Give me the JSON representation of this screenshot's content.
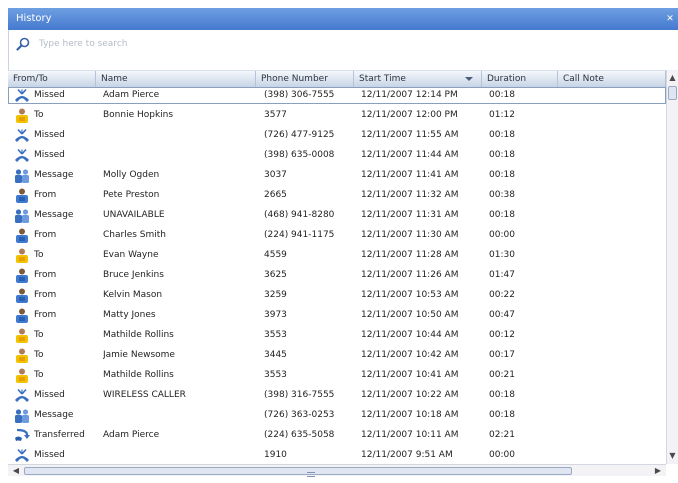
{
  "window": {
    "title": "History"
  },
  "search": {
    "placeholder": "Type here to search"
  },
  "columns": [
    {
      "key": "from_to",
      "label": "From/To"
    },
    {
      "key": "name",
      "label": "Name"
    },
    {
      "key": "phone",
      "label": "Phone Number"
    },
    {
      "key": "start_time",
      "label": "Start Time",
      "sorted": "descending"
    },
    {
      "key": "duration",
      "label": "Duration"
    },
    {
      "key": "call_note",
      "label": "Call Note"
    }
  ],
  "rows": [
    {
      "type": "Missed",
      "icon": "missed-call-icon",
      "name": "Adam Pierce",
      "phone": "(398) 306-7555",
      "start": "12/11/2007 12:14 PM",
      "duration": "00:18",
      "note": "",
      "selected": true
    },
    {
      "type": "To",
      "icon": "outgoing-call-icon",
      "name": "Bonnie Hopkins",
      "phone": "3577",
      "start": "12/11/2007 12:00 PM",
      "duration": "01:12",
      "note": ""
    },
    {
      "type": "Missed",
      "icon": "missed-call-icon",
      "name": "",
      "phone": "(726) 477-9125",
      "start": "12/11/2007 11:55 AM",
      "duration": "00:18",
      "note": ""
    },
    {
      "type": "Missed",
      "icon": "missed-call-icon",
      "name": "",
      "phone": "(398) 635-0008",
      "start": "12/11/2007 11:44 AM",
      "duration": "00:18",
      "note": ""
    },
    {
      "type": "Message",
      "icon": "voicemail-icon",
      "name": "Molly Ogden",
      "phone": "3037",
      "start": "12/11/2007 11:41 AM",
      "duration": "00:18",
      "note": ""
    },
    {
      "type": "From",
      "icon": "incoming-call-icon",
      "name": "Pete Preston",
      "phone": "2665",
      "start": "12/11/2007 11:32 AM",
      "duration": "00:38",
      "note": ""
    },
    {
      "type": "Message",
      "icon": "voicemail-icon",
      "name": "UNAVAILABLE",
      "phone": "(468) 941-8280",
      "start": "12/11/2007 11:31 AM",
      "duration": "00:18",
      "note": ""
    },
    {
      "type": "From",
      "icon": "incoming-call-icon",
      "name": "Charles Smith",
      "phone": "(224) 941-1175",
      "start": "12/11/2007 11:30 AM",
      "duration": "00:00",
      "note": ""
    },
    {
      "type": "To",
      "icon": "outgoing-call-icon",
      "name": "Evan Wayne",
      "phone": "4559",
      "start": "12/11/2007 11:28 AM",
      "duration": "01:30",
      "note": ""
    },
    {
      "type": "From",
      "icon": "incoming-call-icon",
      "name": "Bruce Jenkins",
      "phone": "3625",
      "start": "12/11/2007 11:26 AM",
      "duration": "01:47",
      "note": ""
    },
    {
      "type": "From",
      "icon": "incoming-call-icon",
      "name": "Kelvin Mason",
      "phone": "3259",
      "start": "12/11/2007 10:53 AM",
      "duration": "00:22",
      "note": ""
    },
    {
      "type": "From",
      "icon": "incoming-call-icon",
      "name": "Matty Jones",
      "phone": "3973",
      "start": "12/11/2007 10:50 AM",
      "duration": "00:47",
      "note": ""
    },
    {
      "type": "To",
      "icon": "outgoing-call-icon",
      "name": "Mathilde Rollins",
      "phone": "3553",
      "start": "12/11/2007 10:44 AM",
      "duration": "00:12",
      "note": ""
    },
    {
      "type": "To",
      "icon": "outgoing-call-icon",
      "name": "Jamie Newsome",
      "phone": "3445",
      "start": "12/11/2007 10:42 AM",
      "duration": "00:17",
      "note": ""
    },
    {
      "type": "To",
      "icon": "outgoing-call-icon",
      "name": "Mathilde Rollins",
      "phone": "3553",
      "start": "12/11/2007 10:41 AM",
      "duration": "00:21",
      "note": ""
    },
    {
      "type": "Missed",
      "icon": "missed-call-icon",
      "name": "WIRELESS CALLER",
      "phone": "(398) 316-7555",
      "start": "12/11/2007 10:22 AM",
      "duration": "00:18",
      "note": ""
    },
    {
      "type": "Message",
      "icon": "voicemail-icon",
      "name": "",
      "phone": "(726) 363-0253",
      "start": "12/11/2007 10:18 AM",
      "duration": "00:18",
      "note": ""
    },
    {
      "type": "Transferred",
      "icon": "transferred-call-icon",
      "name": "Adam Pierce",
      "phone": "(224) 635-5058",
      "start": "12/11/2007 10:11 AM",
      "duration": "02:21",
      "note": ""
    },
    {
      "type": "Missed",
      "icon": "missed-call-icon",
      "name": "",
      "phone": "1910",
      "start": "12/11/2007 9:51 AM",
      "duration": "00:00",
      "note": ""
    }
  ],
  "colors": {
    "titlebar": "#4479cf",
    "header": "#c6d4e6",
    "missed": "#3a6fbf",
    "outgoing": "#f2c200",
    "incoming": "#3f79d1"
  }
}
